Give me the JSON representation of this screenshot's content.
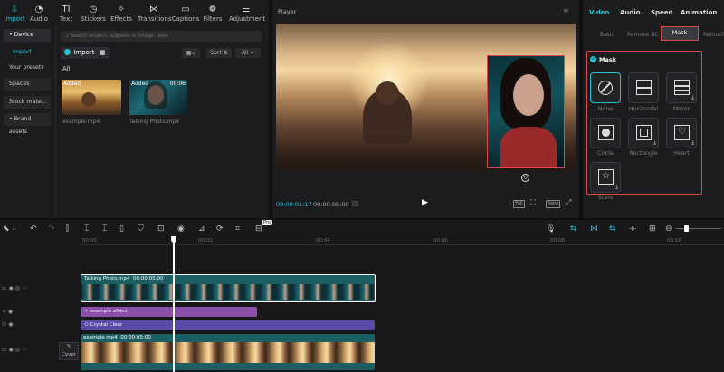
{
  "toolbar": {
    "tabs": [
      {
        "label": "Import",
        "icon": "import-icon"
      },
      {
        "label": "Audio",
        "icon": "audio-icon"
      },
      {
        "label": "Text",
        "icon": "text-icon"
      },
      {
        "label": "Stickers",
        "icon": "stickers-icon"
      },
      {
        "label": "Effects",
        "icon": "effects-icon"
      },
      {
        "label": "Transitions",
        "icon": "transitions-icon"
      },
      {
        "label": "Captions",
        "icon": "captions-icon"
      },
      {
        "label": "Filters",
        "icon": "filters-icon"
      },
      {
        "label": "Adjustment",
        "icon": "adjustment-icon"
      }
    ]
  },
  "sidebar": {
    "items": [
      {
        "label": "• Device"
      },
      {
        "label": "Import"
      },
      {
        "label": "Your presets"
      },
      {
        "label": "Spaces"
      },
      {
        "label": "Stock mate..."
      },
      {
        "label": "• Brand assets"
      }
    ]
  },
  "media": {
    "search_placeholder": "Search project, subjects in image, lines",
    "import_label": "Import",
    "sort_label": "Sort",
    "all_filter": "All",
    "all_heading": "All",
    "items": [
      {
        "name": "example.mp4",
        "badge": "Added",
        "duration": ""
      },
      {
        "name": "Talking Photo.mp4",
        "badge": "Added",
        "duration": "00:06"
      }
    ]
  },
  "player": {
    "title": "Player",
    "current_time": "00:00:01:17",
    "total_time": "00:00:05:00",
    "btn_full": "Full",
    "btn_ratio": "Ratio"
  },
  "inspector": {
    "tabs": [
      "Video",
      "Audio",
      "Speed",
      "Animation"
    ],
    "subtabs": [
      "Basic",
      "Remove BG",
      "Mask",
      "Retouch"
    ],
    "section_title": "Mask",
    "masks": [
      {
        "label": "None",
        "icon": "none-mask-icon"
      },
      {
        "label": "Horizontal",
        "icon": "horizontal-mask-icon"
      },
      {
        "label": "Mirror",
        "icon": "mirror-mask-icon"
      },
      {
        "label": "Circle",
        "icon": "circle-mask-icon"
      },
      {
        "label": "Rectangle",
        "icon": "rectangle-mask-icon"
      },
      {
        "label": "Heart",
        "icon": "heart-mask-icon"
      },
      {
        "label": "Stars",
        "icon": "stars-mask-icon"
      }
    ]
  },
  "timeline": {
    "ticks": [
      "00:00",
      "00:02",
      "00:04",
      "00:06",
      "00:08",
      "00:10"
    ],
    "pro_badge": "Pro",
    "cover_label": "Cover",
    "clips": {
      "overlay": {
        "name": "Talking Photo.mp4",
        "duration": "00:00:05:00"
      },
      "effect": {
        "name": "example effect"
      },
      "filter": {
        "name": "Crystal Clear"
      },
      "main": {
        "name": "example.mp4",
        "duration": "00:00:05:00"
      }
    }
  },
  "colors": {
    "accent": "#24c3d4",
    "highlight_red": "#e0474c",
    "effect_clip": "#8a4fa8",
    "filter_clip": "#5a4aa8",
    "video_clip": "#1d5e62"
  }
}
